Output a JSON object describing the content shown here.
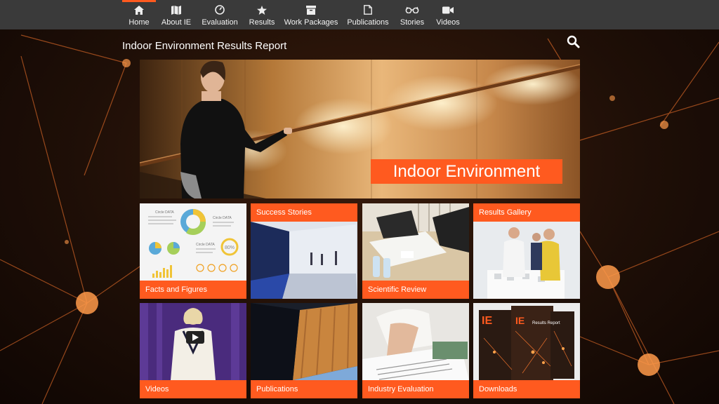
{
  "nav": {
    "items": [
      {
        "label": "Home",
        "icon": "home-icon",
        "active": true
      },
      {
        "label": "About IE",
        "icon": "map-icon"
      },
      {
        "label": "Evaluation",
        "icon": "gauge-icon"
      },
      {
        "label": "Results",
        "icon": "star-icon"
      },
      {
        "label": "Work Packages",
        "icon": "archive-icon"
      },
      {
        "label": "Publications",
        "icon": "document-icon"
      },
      {
        "label": "Stories",
        "icon": "glasses-icon"
      },
      {
        "label": "Videos",
        "icon": "video-camera-icon"
      }
    ]
  },
  "page": {
    "title": "Indoor Environment Results Report",
    "search_icon": "search-icon"
  },
  "hero": {
    "label": "Indoor Environment"
  },
  "tiles": [
    {
      "label": "Facts and Figures"
    },
    {
      "label": "Success Stories"
    },
    {
      "label": "Scientific Review"
    },
    {
      "label": "Results Gallery"
    },
    {
      "label": "Videos"
    },
    {
      "label": "Publications"
    },
    {
      "label": "Industry Evaluation"
    },
    {
      "label": "Downloads"
    }
  ],
  "infographic": {
    "circle_label_1": "Circle DATA",
    "circle_label_2": "Circle DATA",
    "circle_label_3": "Circle DATA",
    "percent": "80%"
  },
  "book": {
    "letters": "IE",
    "subtitle": "Results Report"
  },
  "colors": {
    "accent": "#ff5a1f",
    "nav_bg": "#3a3a3a"
  }
}
